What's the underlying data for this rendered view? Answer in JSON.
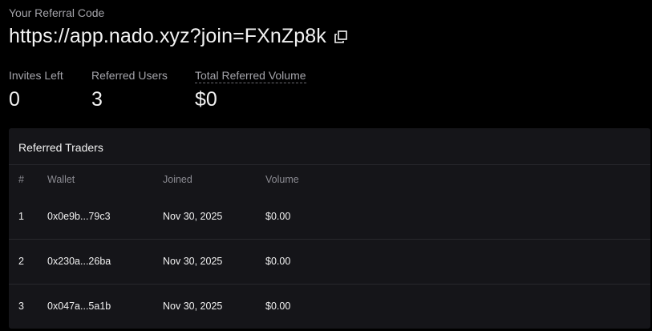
{
  "referral": {
    "label": "Your Referral Code",
    "code": "https://app.nado.xyz?join=FXnZp8k",
    "copy_icon": "copy-icon"
  },
  "stats": {
    "invites_left": {
      "label": "Invites Left",
      "value": "0"
    },
    "referred_users": {
      "label": "Referred Users",
      "value": "3"
    },
    "total_volume": {
      "label": "Total Referred Volume",
      "value": "$0"
    }
  },
  "traders": {
    "title": "Referred Traders",
    "columns": [
      "#",
      "Wallet",
      "Joined",
      "Volume"
    ],
    "rows": [
      {
        "index": "1",
        "wallet": "0x0e9b...79c3",
        "joined": "Nov 30, 2025",
        "volume": "$0.00"
      },
      {
        "index": "2",
        "wallet": "0x230a...26ba",
        "joined": "Nov 30, 2025",
        "volume": "$0.00"
      },
      {
        "index": "3",
        "wallet": "0x047a...5a1b",
        "joined": "Nov 30, 2025",
        "volume": "$0.00"
      }
    ]
  },
  "colors": {
    "background": "#000000",
    "panel": "#151519",
    "muted_text": "#a4a4aa",
    "text": "#f2f2f2"
  }
}
